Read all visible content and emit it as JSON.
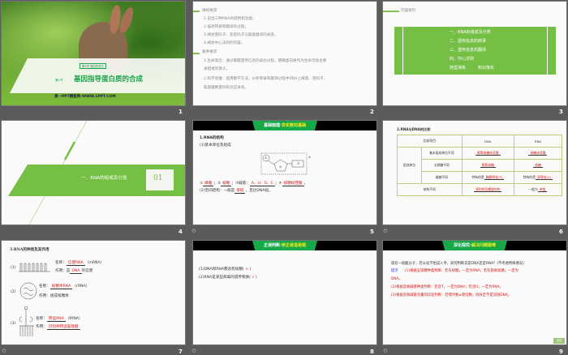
{
  "slides": [
    {
      "number": "1",
      "chapter_badge": "第4章 基因的表达",
      "section": "第1节",
      "title": "基因指导蛋白质的合成",
      "watermark": "第一PPT模板网-WWW.1PPT.COM"
    },
    {
      "number": "2",
      "heading1": "课标要求",
      "items1": [
        "1.说出三种RNA的结构和功能。",
        "2.描述转录和翻译的过程。",
        "3.阐述密码子、反密码子与氨基酸间的关系。",
        "4.阐述中心法则的内容。"
      ],
      "heading2": "素养要求",
      "items2": [
        "1.生命观念：通过掌握遗传信息的表达过程，明确蛋白质作为生命活动主要",
        "承担者的意义。",
        "2.科学思维：运用数学方法，分析转录和翻译过程中DNA上碱基、密码子、",
        "氨基酸数量间的对应关系。"
      ]
    },
    {
      "number": "3",
      "heading": "内容索引",
      "items": [
        "一、RNA的组成及分类",
        "二、遗传信息的转录",
        "三、遗传信息的翻译",
        "四、中心法则"
      ],
      "last_a": "随堂演练",
      "last_b": "知识落实"
    },
    {
      "number": "4",
      "title": "一、RNA的组成及分类",
      "index": "01"
    },
    {
      "number": "5",
      "banner_a": "基础梳理·",
      "banner_b": "夯实教材基础",
      "h1": "1.RNA的结构",
      "h2": "(1)基本单位及组成",
      "labels": [
        "①",
        "②",
        "③",
        "④"
      ],
      "a1": "磷酸",
      "a2": "核糖",
      "a3_prefix": "③碱基：",
      "a3": "A、U、G、C",
      "a4": "核糖核苷酸",
      "line2_prefix": "(2)空间结构：一般是",
      "line2_ans": "单链",
      "line2_suffix": "，且比DNA短。"
    },
    {
      "number": "6",
      "heading": "2.RNA与DNA的比较",
      "head": [
        "比较项目",
        "DNA",
        "RNA"
      ],
      "group": "组成单位",
      "rows": [
        [
          "基本组成单位不同",
          "脱氧核糖核苷酸",
          "核糖核苷酸"
        ],
        [
          "五碳糖不同",
          "脱氧核糖",
          "核糖"
        ],
        [
          "碱基不同",
          "特有的是",
          "胸腺嘧啶(T)",
          "特有的是",
          "尿嘧啶(U)"
        ]
      ],
      "structure": [
        "结构不同",
        "规则的双螺旋结构",
        "一般为",
        "单链"
      ]
    },
    {
      "number": "7",
      "heading": "3.RNA的种类及其作用",
      "name_label": "名称：",
      "func_label": "作用：",
      "items": [
        {
          "idx": "(1)",
          "name": "信使RNA",
          "abbr": "（mRNA）",
          "func_pre": "是",
          "func": "DNA",
          "func_post": "的信使"
        },
        {
          "idx": "(2)",
          "name": "核糖体RNA",
          "abbr": "（rRNA）",
          "func": "组成核糖体"
        },
        {
          "idx": "(3)",
          "name": "转运RNA",
          "abbr": "（tRNA）",
          "func": "识别并转运氨基酸"
        }
      ]
    },
    {
      "number": "8",
      "banner_a": "正误判断·",
      "banner_b": "矫正易混易错",
      "q1": "(1)DNA和RNA都含有核糖(",
      "a1": "×",
      "q2": "(2)RNA是某些病毒的遗传物质(",
      "a2": "√",
      "close": ")"
    },
    {
      "number": "9",
      "banner_a": "深化探究·",
      "banner_b": "解决问题疑难",
      "question": "现有一核酸分子，若从化学组成入手，如何判断其是DNA还是RNA？(不考虑特殊情况)",
      "hint": "提示",
      "lines": [
        "(1)根据五碳糖种类判断：若有核糖，一定为RNA；若有脱氧核糖，一定为",
        "DNA。",
        "(2)根据含氮碱基种类判断：若含T，一定为DNA；若含U，一定为RNA。",
        "(3)根据含氮碱基含量的比较判断：若嘌呤数≠嘧啶数，则肯定不是双链DNA。"
      ],
      "back": "返回"
    }
  ],
  "colors": {
    "accent_green": "#7dc651",
    "title_green": "#1aa34a",
    "answer_red": "#d21a1a",
    "background": "#5b5b5b"
  }
}
